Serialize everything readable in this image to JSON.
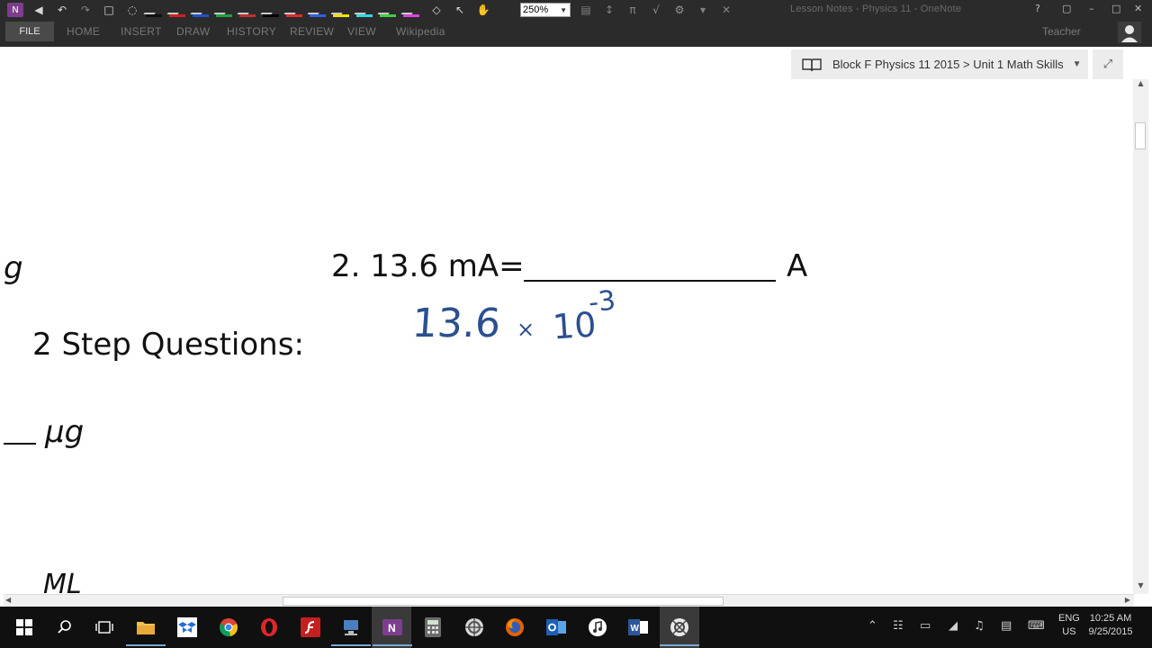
{
  "toolbar": {
    "zoom_value": "250%",
    "window_title": "Lesson Notes - Physics 11 - OneNote"
  },
  "ribbon": {
    "file_tab": "FILE",
    "tabs": [
      "HOME",
      "INSERT",
      "DRAW",
      "HISTORY",
      "REVIEW",
      "VIEW",
      "Wikipedia"
    ],
    "user_name": "Teacher"
  },
  "notebook": {
    "breadcrumb": "Block F Physics 11 2015 > Unit 1 Math Skills"
  },
  "page": {
    "question_2": "2.  13.6 mA=",
    "question_2_unit": "A",
    "left_fragment_top": "g",
    "section_heading": "2 Step Questions:",
    "left_fragment_mid": "μg",
    "left_fragment_bottom": "ML",
    "handwriting_value": "13.6",
    "handwriting_times": "×",
    "handwriting_base": "10",
    "handwriting_exponent": "-3"
  },
  "taskbar": {
    "language_line1": "ENG",
    "language_line2": "US",
    "time": "10:25 AM",
    "date": "9/25/2015"
  },
  "colors": {
    "ink_blue": "#2c4f8f",
    "dark_chrome": "#2b2b2b",
    "taskbar": "#101010"
  }
}
